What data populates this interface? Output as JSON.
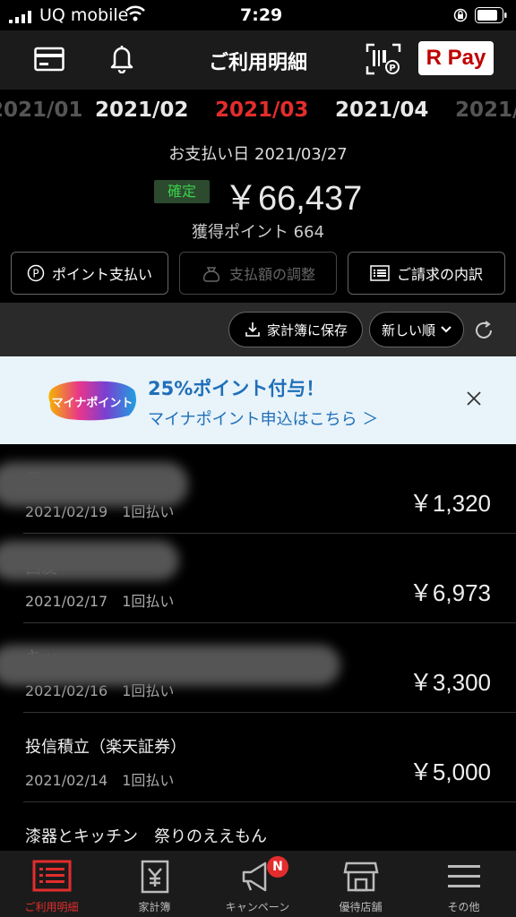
{
  "status_bar": {
    "carrier": "UQ mobile",
    "time": "7:29"
  },
  "nav": {
    "title": "ご利用明細",
    "rpay_label": "R Pay"
  },
  "months": {
    "prev2": "2021/01",
    "prev": "2021/02",
    "current": "2021/03",
    "next": "2021/04",
    "next2": "2021/05"
  },
  "summary": {
    "pay_date": "お支払い日 2021/03/27",
    "status": "確定",
    "amount": "￥66,437",
    "points": "獲得ポイント 664"
  },
  "actions": {
    "point_pay": "ポイント支払い",
    "adjust": "支払額の調整",
    "invoice": "ご請求の内訳"
  },
  "toolbar": {
    "save": "家計簿に保存",
    "sort": "新しい順"
  },
  "banner": {
    "logo_text": "マイナポイント",
    "title": "25%ポイント付与！",
    "subtitle": "マイナポイント申込はこちら ＞"
  },
  "transactions": [
    {
      "name": "フォ",
      "date": "2021/02/19　1回払い",
      "amount": "￥1,320"
    },
    {
      "name": "西友",
      "date": "2021/02/17　1回払い",
      "amount": "￥6,973"
    },
    {
      "name": "キッ",
      "date": "2021/02/16　1回払い",
      "amount": "￥3,300"
    },
    {
      "name": "投信積立（楽天証券）",
      "date": "2021/02/14　1回払い",
      "amount": "￥5,000"
    },
    {
      "name": "漆器とキッチン　祭りのええもん",
      "date": "",
      "amount": ""
    }
  ],
  "bottom_nav": [
    {
      "label": "ご利用明細"
    },
    {
      "label": "家計簿"
    },
    {
      "label": "キャンペーン",
      "badge": "N"
    },
    {
      "label": "優待店舗"
    },
    {
      "label": "その他"
    }
  ],
  "colors": {
    "accent": "#e32d2d",
    "link": "#1f6fb8",
    "confirmed": "#3bd04a"
  }
}
